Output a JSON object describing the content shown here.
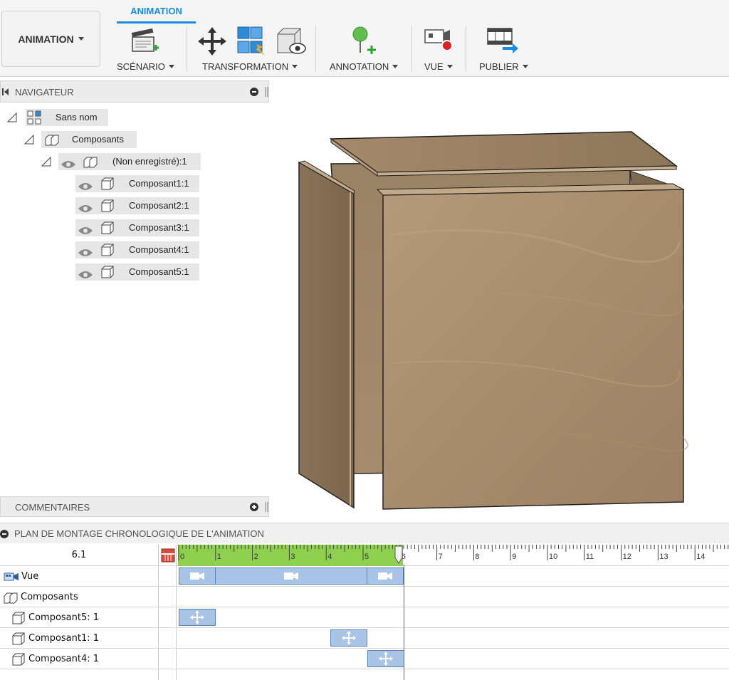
{
  "toolbar": {
    "workspace_label": "ANIMATION",
    "active_tab": "ANIMATION",
    "groups": {
      "scenario": "SCÉNARIO",
      "transformation": "TRANSFORMATION",
      "annotation": "ANNOTATION",
      "vue": "VUE",
      "publier": "PUBLIER"
    }
  },
  "browser": {
    "title": "NAVIGATEUR",
    "root": "Sans nom",
    "components_folder": "Composants",
    "occurrence": "(Non enregistré):1",
    "components": [
      "Composant1:1",
      "Composant2:1",
      "Composant3:1",
      "Composant4:1",
      "Composant5:1"
    ]
  },
  "comments": {
    "title": "COMMENTAIRES"
  },
  "storyboard": {
    "title": "PLAN DE MONTAGE CHRONOLOGIQUE DE L'ANIMATION",
    "current_time": "6.1",
    "ruler_ticks": [
      "0",
      "1",
      "2",
      "3",
      "4",
      "5",
      "6",
      "7",
      "8",
      "9",
      "10",
      "11",
      "12",
      "13",
      "14"
    ],
    "rows": [
      "Vue",
      "Composants",
      "Composant5: 1",
      "Composant1: 1",
      "Composant4: 1"
    ],
    "colors": {
      "accent": "#1a8ae3",
      "played": "#8fd14f",
      "bar": "#a8c4e6"
    }
  }
}
